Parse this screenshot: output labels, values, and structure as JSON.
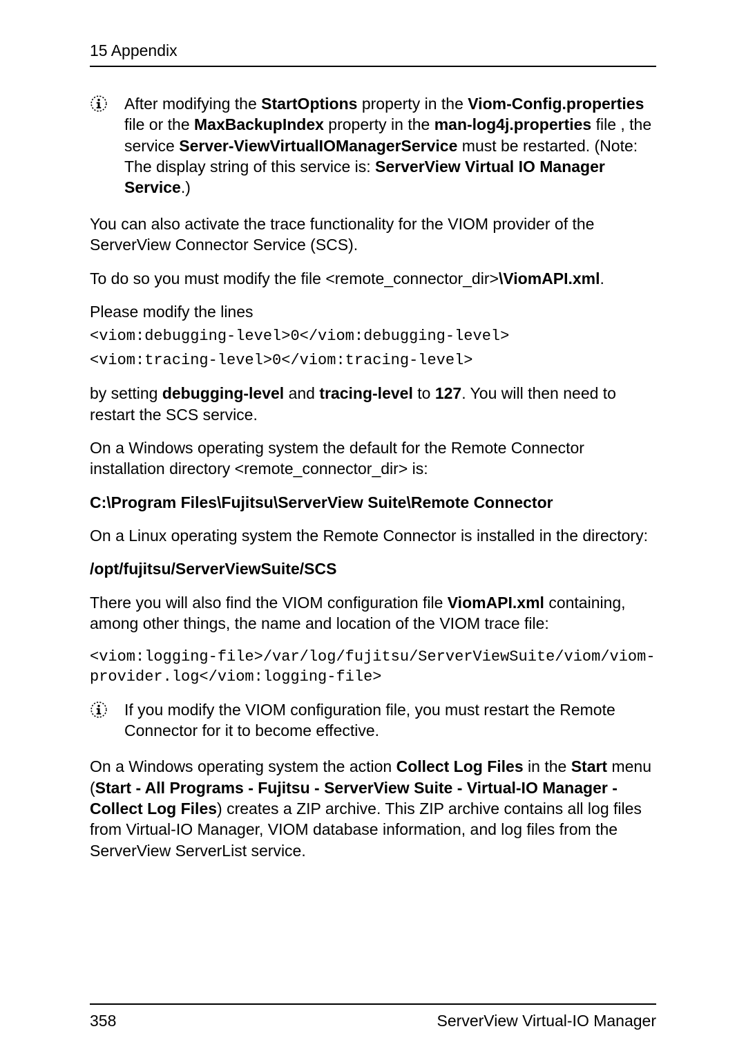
{
  "header": {
    "title": "15 Appendix"
  },
  "note1": {
    "p1a": "After modifying the ",
    "p1b": "StartOptions",
    "p1c": " property in the ",
    "p1d": "Viom-Config.properties",
    "p1e": " file or the ",
    "p1f": "MaxBackupIndex",
    "p1g": " property in the ",
    "p1h": "man-log4j.properties",
    "p1i": " file , the service ",
    "p1j": "Server-ViewVirtualIOManagerService",
    "p1k": " must be restarted. (Note: The display string of this service is: ",
    "p1l": "ServerView Virtual IO Manager Service",
    "p1m": ".)"
  },
  "p2": "You can also activate the trace functionality for the VIOM provider of the ServerView Connector Service (SCS).",
  "p3a": "To do so you must modify the file <remote_connector_dir>",
  "p3b": "\\ViomAPI.xml",
  "p3c": ".",
  "p4": "Please modify the lines",
  "code1": "<viom:debugging-level>0</viom:debugging-level>",
  "code2": "<viom:tracing-level>0</viom:tracing-level>",
  "p5a": "by setting ",
  "p5b": "debugging-level",
  "p5c": " and ",
  "p5d": "tracing-level",
  "p5e": " to ",
  "p5f": "127",
  "p5g": ". You will then need to restart the SCS service.",
  "p6": "On a Windows operating system the default for the Remote Connector installation directory <remote_connector_dir> is:",
  "p7": "C:\\Program Files\\Fujitsu\\ServerView Suite\\Remote Connector",
  "p8": "On a Linux operating system the Remote Connector is installed in the directory:",
  "p9": "/opt/fujitsu/ServerViewSuite/SCS",
  "p10a": "There you will also find the VIOM configuration file ",
  "p10b": "ViomAPI.xml",
  "p10c": " containing, among other things, the name and location of the VIOM trace file:",
  "code3": "<viom:logging-file>/var/log/fujitsu/ServerViewSuite/viom/viom-provider.log</viom:logging-file>",
  "note2": {
    "text": "If you modify the VIOM configuration file, you must restart the Remote Connector for it to become effective."
  },
  "p11a": "On a Windows operating system the action ",
  "p11b": "Collect Log Files",
  "p11c": " in the ",
  "p11d": "Start",
  "p11e": " menu (",
  "p11f": "Start - All Programs - Fujitsu - ServerView Suite - Virtual-IO Manager - Collect Log Files",
  "p11g": ") creates a ZIP archive. This ZIP archive contains all log files from Virtual-IO Manager, VIOM database information, and log files from the ServerView ServerList service.",
  "footer": {
    "page": "358",
    "title": "ServerView Virtual-IO Manager"
  }
}
